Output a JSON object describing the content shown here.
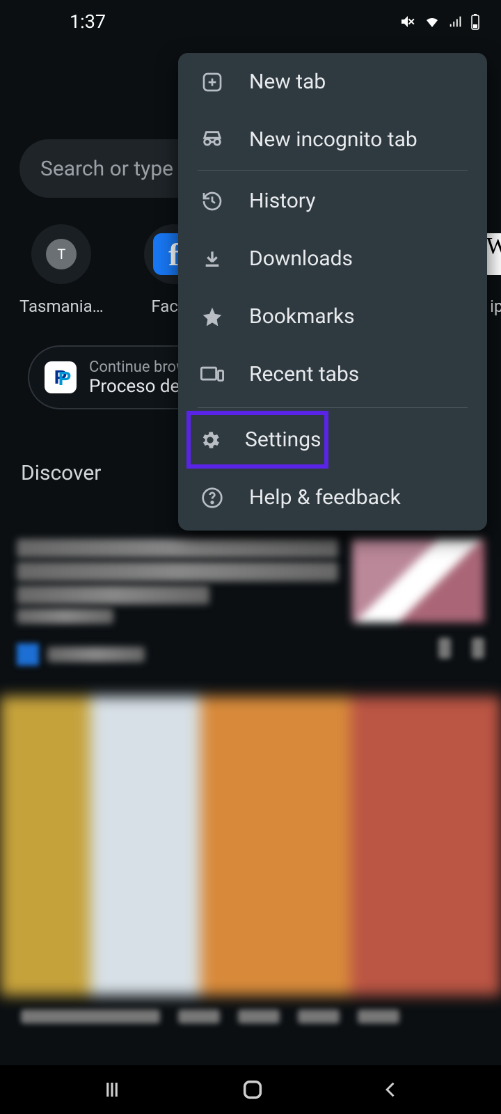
{
  "status": {
    "time": "1:37"
  },
  "search": {
    "placeholder": "Search or type web address"
  },
  "quick_links": [
    {
      "icon_text": "T",
      "label": "Tasmania…"
    },
    {
      "icon_text": "f",
      "label": "Faceb"
    },
    {
      "icon_text": "W",
      "label": "ip"
    }
  ],
  "continue": {
    "line1": "Continue browsing",
    "line2": "Proceso de"
  },
  "discover": {
    "heading": "Discover"
  },
  "menu": {
    "items": [
      {
        "id": "new-tab",
        "label": "New tab"
      },
      {
        "id": "incognito",
        "label": "New incognito tab"
      },
      {
        "id": "history",
        "label": "History"
      },
      {
        "id": "downloads",
        "label": "Downloads"
      },
      {
        "id": "bookmarks",
        "label": "Bookmarks"
      },
      {
        "id": "recent-tabs",
        "label": "Recent tabs"
      },
      {
        "id": "settings",
        "label": "Settings"
      },
      {
        "id": "help",
        "label": "Help & feedback"
      }
    ],
    "highlighted_index": 6
  }
}
